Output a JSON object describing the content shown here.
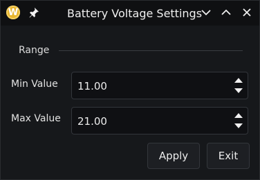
{
  "window": {
    "title": "Battery Voltage Settings",
    "app_icon_letter": "W",
    "accent": "#e8b52e"
  },
  "range": {
    "section_label": "Range",
    "min_label": "Min Value",
    "min_value": "11.00",
    "max_label": "Max Value",
    "max_value": "21.00"
  },
  "buttons": {
    "apply": "Apply",
    "exit": "Exit"
  },
  "icons": [
    "app-logo-icon",
    "pin-icon",
    "chevron-down-icon",
    "chevron-up-icon",
    "close-icon",
    "spin-up-icon",
    "spin-down-icon"
  ]
}
